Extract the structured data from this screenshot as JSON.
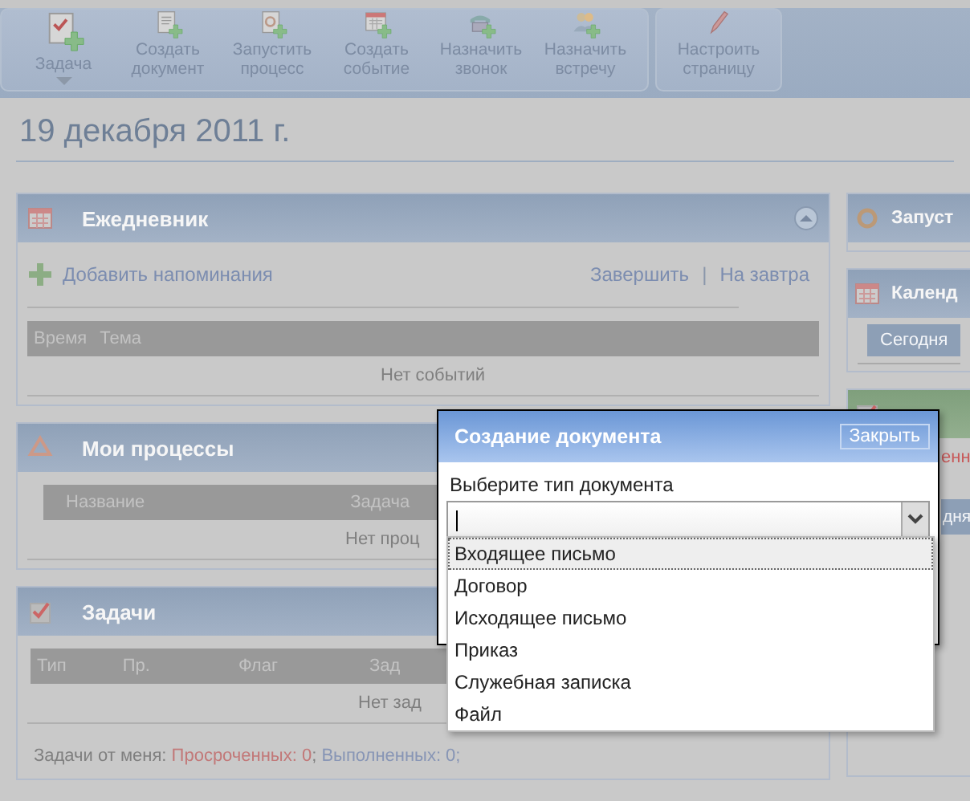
{
  "toolbar": {
    "groups": [
      {
        "buttons": [
          {
            "label": "Задача",
            "kind": "task",
            "menu": true
          },
          {
            "label": "Создать документ",
            "kind": "document",
            "menu": false
          },
          {
            "label": "Запустить процесс",
            "kind": "process",
            "menu": false
          },
          {
            "label": "Создать событие",
            "kind": "event",
            "menu": false
          },
          {
            "label": "Назначить звонок",
            "kind": "call",
            "menu": false
          },
          {
            "label": "Назначить встречу",
            "kind": "meeting",
            "menu": false
          }
        ]
      },
      {
        "buttons": [
          {
            "label": "Настроить страницу",
            "kind": "edit",
            "menu": false
          }
        ]
      }
    ]
  },
  "date_heading": "19 декабря 2011 г.",
  "panels": [
    {
      "title": "Ежедневник",
      "kind": "diary",
      "add_link": "Добавить напоминания",
      "actions": [
        "Завершить",
        "На завтра"
      ],
      "actions_separator": "|",
      "columns": [
        "Время",
        "Тема"
      ],
      "empty": "Нет событий"
    },
    {
      "title": "Мои процессы",
      "kind": "processes",
      "columns": [
        "Название",
        "Задача"
      ],
      "empty": "Нет проц"
    },
    {
      "title": "Задачи",
      "kind": "tasks",
      "columns": [
        "Тип",
        "Пр.",
        "Флаг",
        "Зад"
      ],
      "empty": "Нет зад",
      "footer": {
        "label": "Задачи от меня:",
        "overdue": "Просроченных: 0",
        "separator": ";",
        "done": "Выполненных: 0;"
      }
    }
  ],
  "side_panels": [
    {
      "title": "Запуст",
      "kind": "process"
    },
    {
      "title": "Календ",
      "kind": "calendar",
      "button": "Сегодня"
    },
    {
      "kind": "tasks",
      "text": "енн",
      "button": "дня"
    }
  ],
  "dialog": {
    "title": "Создание документа",
    "close": "Закрыть",
    "label": "Выберите тип документа",
    "options": [
      {
        "label": "Входящее письмо",
        "selected": true
      },
      {
        "label": "Договор",
        "selected": false
      },
      {
        "label": "Исходящее письмо",
        "selected": false
      },
      {
        "label": "Приказ",
        "selected": false
      },
      {
        "label": "Служебная записка",
        "selected": false
      },
      {
        "label": "Файл",
        "selected": false
      }
    ]
  }
}
